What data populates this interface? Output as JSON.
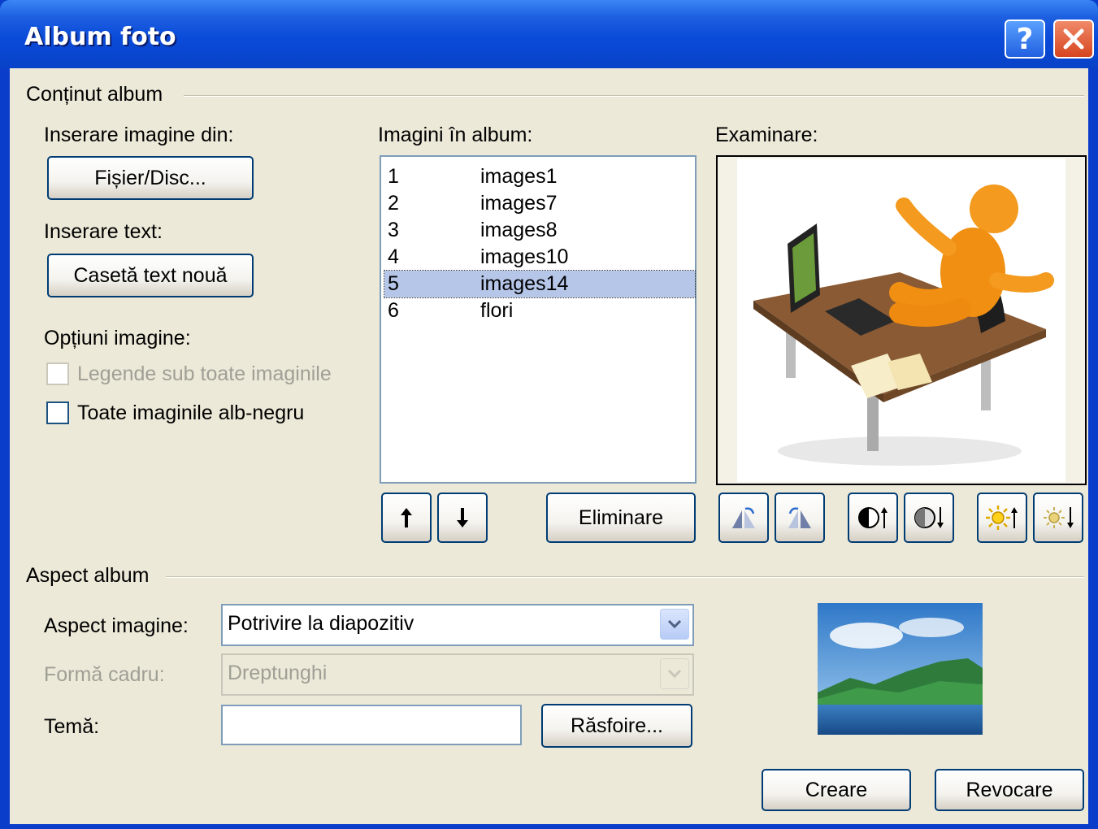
{
  "window": {
    "title": "Album foto",
    "help_label": "?",
    "close_label": "✕"
  },
  "content_group": {
    "title": "Conținut album",
    "insert_picture_label": "Inserare imagine din:",
    "file_disk_button": "Fișier/Disc...",
    "insert_text_label": "Inserare text:",
    "new_text_box_button": "Casetă text nouă",
    "picture_options_label": "Opțiuni imagine:",
    "captions_checkbox": {
      "label": "Legende sub toate imaginile",
      "checked": false,
      "enabled": false
    },
    "black_white_checkbox": {
      "label": "Toate imaginile alb-negru",
      "checked": false,
      "enabled": true
    }
  },
  "album_list": {
    "label": "Imagini în album:",
    "items": [
      {
        "num": "1",
        "name": "images1"
      },
      {
        "num": "2",
        "name": "images7"
      },
      {
        "num": "3",
        "name": "images8"
      },
      {
        "num": "4",
        "name": "images10"
      },
      {
        "num": "5",
        "name": "images14"
      },
      {
        "num": "6",
        "name": "flori"
      }
    ],
    "selected_index": 4,
    "move_up_icon": "arrow-up-icon",
    "move_down_icon": "arrow-down-icon",
    "remove_button": "Eliminare"
  },
  "preview": {
    "label": "Examinare:",
    "tool_icons": [
      "rotate-left-icon",
      "rotate-right-icon",
      "contrast-up-icon",
      "contrast-down-icon",
      "brightness-up-icon",
      "brightness-down-icon"
    ]
  },
  "layout_group": {
    "title": "Aspect album",
    "picture_layout_label": "Aspect imagine:",
    "picture_layout_value": "Potrivire la diapozitiv",
    "frame_shape_label": "Formă cadru:",
    "frame_shape_value": "Dreptunghi",
    "theme_label": "Temă:",
    "theme_value": "",
    "browse_button": "Răsfoire..."
  },
  "footer": {
    "create_button": "Creare",
    "cancel_button": "Revocare"
  },
  "colors": {
    "titlebar": "#0a4bd9",
    "dialog_bg": "#ece9d8",
    "selection": "#b5c6e9",
    "button_border": "#003c74"
  }
}
